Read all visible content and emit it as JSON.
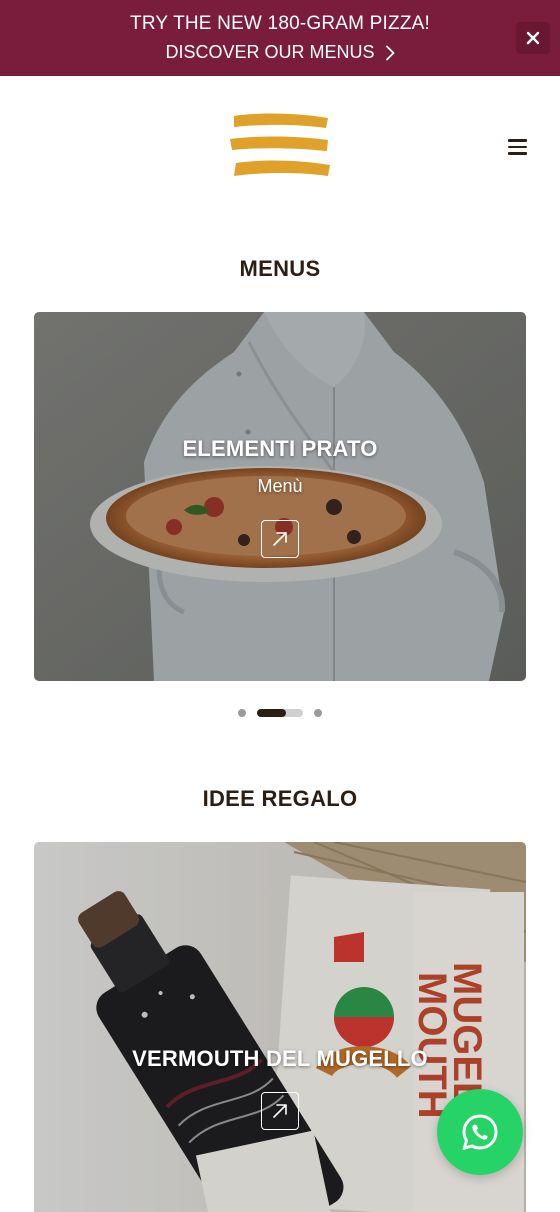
{
  "promo": {
    "headline": "TRY THE NEW 180-GRAM PIZZA!",
    "link_label": "DISCOVER OUR MENUS",
    "bg_color": "#7a1d3c",
    "close_icon": "close-icon"
  },
  "header": {
    "logo_icon": "brush-stripes-logo",
    "logo_color": "#e0a12a",
    "menu_icon": "hamburger-icon"
  },
  "sections": {
    "menus": {
      "title": "MENUS",
      "card": {
        "title": "ELEMENTI PRATO",
        "subtitle": "Menù",
        "icon": "external-arrow-icon"
      },
      "carousel": {
        "slides": 3,
        "active_index": 1
      }
    },
    "gifts": {
      "title": "IDEE REGALO",
      "card": {
        "title": "VERMOUTH DEL MUGELLO",
        "icon": "external-arrow-icon"
      }
    }
  },
  "floating": {
    "icon": "whatsapp-icon",
    "color": "#25d366"
  }
}
